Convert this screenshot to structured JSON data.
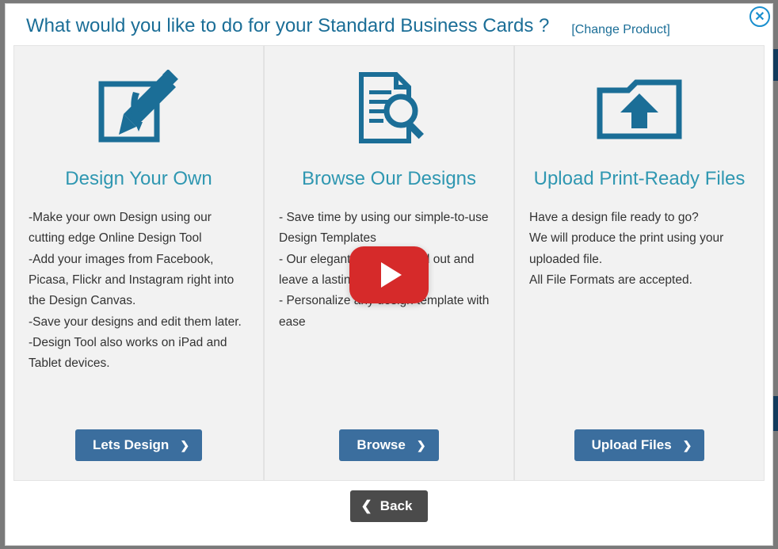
{
  "header": {
    "title": "What would you like to do for your Standard Business Cards ?",
    "change_product": "[Change Product]"
  },
  "panels": {
    "design": {
      "title": "Design Your Own",
      "body": "-Make your own Design using our cutting edge Online Design Tool\n-Add your images from Facebook, Picasa, Flickr and Instagram right into the Design Canvas.\n-Save your designs and edit them later.\n-Design Tool also works on iPad and Tablet devices.",
      "button": "Lets Design"
    },
    "browse": {
      "title": "Browse Our Designs",
      "body": "- Save time by using our simple-to-use Design Templates\n- Our elegant designs stand out and leave a lasting impression\n- Personalize any design template with ease",
      "button": "Browse"
    },
    "upload": {
      "title": "Upload Print-Ready Files",
      "body": "Have a design file ready to go?\nWe will produce the print using your uploaded file.\nAll File Formats are accepted.",
      "button": "Upload Files"
    }
  },
  "footer": {
    "back": "Back"
  },
  "icons": {
    "close": "✕",
    "chevron_right": "❯",
    "chevron_left": "❮"
  },
  "colors": {
    "accent_blue": "#3b6e9e",
    "title_teal": "#2f97b1",
    "header_blue": "#1b6e97",
    "play_red": "#d62a2a",
    "panel_bg": "#f2f2f2",
    "back_gray": "#4b4b4b"
  }
}
